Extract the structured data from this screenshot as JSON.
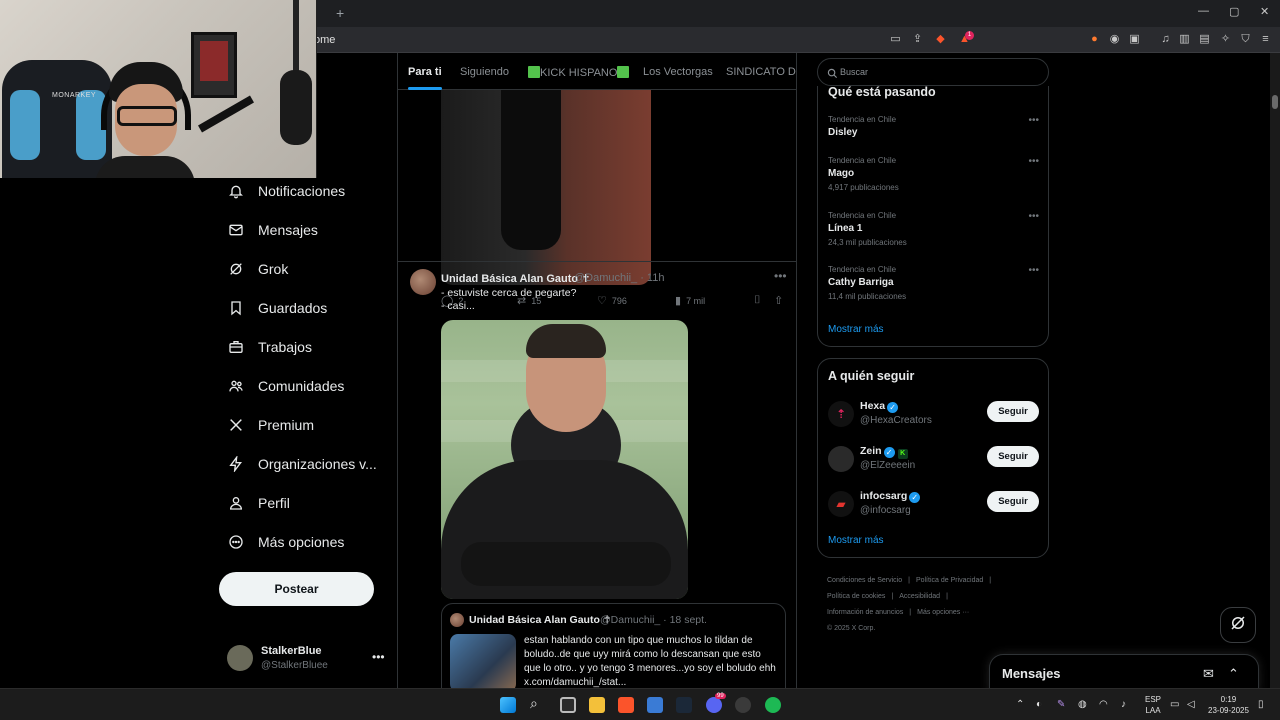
{
  "browser": {
    "url_fragment": "ome",
    "new_tab_label": "+",
    "window_controls": [
      "—",
      "▢",
      "✕"
    ],
    "badge_count": "1"
  },
  "nav": {
    "items": [
      {
        "label": "Notificaciones",
        "icon": "bell-icon"
      },
      {
        "label": "Mensajes",
        "icon": "mail-icon"
      },
      {
        "label": "Grok",
        "icon": "grok-icon"
      },
      {
        "label": "Guardados",
        "icon": "bookmark-icon"
      },
      {
        "label": "Trabajos",
        "icon": "briefcase-icon"
      },
      {
        "label": "Comunidades",
        "icon": "people-icon"
      },
      {
        "label": "Premium",
        "icon": "x-logo-icon"
      },
      {
        "label": "Organizaciones v...",
        "icon": "lightning-icon"
      },
      {
        "label": "Perfil",
        "icon": "person-icon"
      },
      {
        "label": "Más opciones",
        "icon": "more-circle-icon"
      }
    ],
    "post_button": "Postear",
    "profile": {
      "name": "StalkerBlue",
      "handle": "@StalkerBluee",
      "more": "•••"
    }
  },
  "webcam": {
    "chair_brand": "MONARKEY"
  },
  "timeline": {
    "tabs": [
      {
        "label": "Para ti",
        "active": true
      },
      {
        "label": "Siguiendo",
        "active": false
      },
      {
        "label": "KICK HISPANO",
        "active": false
      },
      {
        "label": "Los Vectorgas",
        "active": false
      },
      {
        "label": "SINDICATO DE C",
        "active": false
      }
    ],
    "prev_tweet_actions": {
      "replies": "2",
      "reposts": "15",
      "likes": "796",
      "views": "7 mil"
    },
    "tweet": {
      "name": "Unidad Básica Alan Gauto ✝",
      "handle": "@Damuchii_ · 11h",
      "line1": "- estuviste cerca de pegarte?",
      "line2": "- casi...",
      "more": "•••",
      "quote": {
        "name": "Unidad Básica Alan Gauto ✝",
        "handle": "@Damuchii_ · 18 sept.",
        "lines": [
          "estan hablando con un tipo que muchos lo tildan de",
          "boludo..de que uyy mirá como lo descansan que esto",
          "que lo otro.. y yo tengo 3 menores...yo soy el boludo ehh",
          "x.com/damuchii_/stat..."
        ]
      }
    }
  },
  "sidebar": {
    "search_placeholder": "Buscar",
    "trends_title": "Qué está pasando",
    "trends": [
      {
        "category": "Tendencia en Chile",
        "name": "Disley",
        "count": ""
      },
      {
        "category": "Tendencia en Chile",
        "name": "Mago",
        "count": "4,917 publicaciones"
      },
      {
        "category": "Tendencia en Chile",
        "name": "Línea 1",
        "count": "24,3 mil publicaciones"
      },
      {
        "category": "Tendencia en Chile",
        "name": "Cathy Barriga",
        "count": "11,4 mil publicaciones"
      }
    ],
    "trend_dots": "•••",
    "show_more": "Mostrar más",
    "follow_title": "A quién seguir",
    "follows": [
      {
        "name": "Hexa",
        "handle": "@HexaCreators",
        "button": "Seguir",
        "avatar_color": "#e0245e"
      },
      {
        "name": "Zein",
        "handle": "@ElZeeeein",
        "button": "Seguir",
        "avatar_color": "#333"
      },
      {
        "name": "infocsarg",
        "handle": "@infocsarg",
        "button": "Seguir",
        "avatar_color": "#e3342f"
      }
    ],
    "follow_show_more": "Mostrar más",
    "footer": {
      "l1a": "Condiciones de Servicio",
      "l1b": "Política de Privacidad",
      "l2a": "Política de cookies",
      "l2b": "Accesibilidad",
      "l3a": "Información de anuncios",
      "l3b": "Más opciones ···",
      "l4": "© 2025 X Corp."
    }
  },
  "messages_drawer": {
    "title": "Mensajes"
  },
  "taskbar": {
    "lang_top": "ESP",
    "lang_bottom": "LAA",
    "time": "0:19",
    "date": "23-09-2025",
    "discord_badge": "99"
  },
  "colors": {
    "accent": "#1d9bf0",
    "kick_green": "#53c24c",
    "background": "#000000"
  }
}
